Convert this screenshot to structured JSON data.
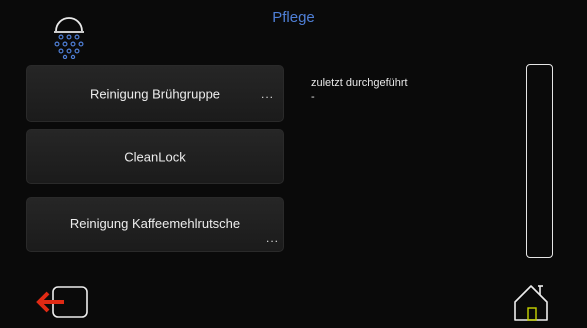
{
  "header": {
    "title": "Pflege",
    "icon": "shower-icon"
  },
  "actions": [
    {
      "label": "Reinigung Brühgruppe",
      "more": "...",
      "icon": "more-icon"
    },
    {
      "label": "CleanLock"
    },
    {
      "label": "Reinigung Kaffeemehlrutsche",
      "more": "...",
      "icon": "more-icon"
    }
  ],
  "info": {
    "label": "zuletzt durchgeführt",
    "value": "-"
  },
  "footer": {
    "back_icon": "exit-icon",
    "home_icon": "home-icon"
  },
  "colors": {
    "title": "#4f7fd6",
    "back_arrow": "#e02a14",
    "home_door": "#c8d400",
    "background": "#0a0a0a"
  }
}
